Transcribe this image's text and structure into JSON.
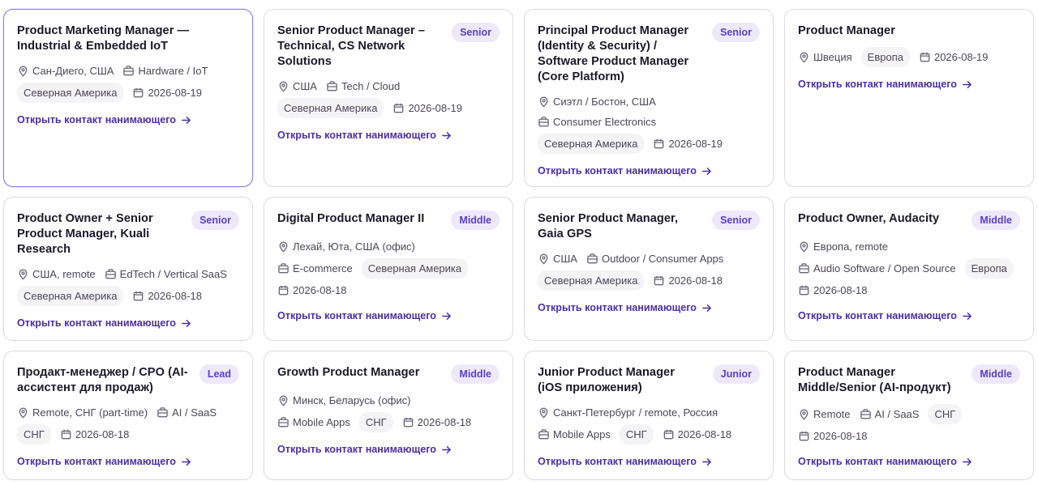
{
  "link_label": "Открыть контакт нанимающего",
  "accent_color": "#4a2fa8",
  "cards": [
    {
      "title": "Product Marketing Manager — Industrial & Embedded IoT",
      "level": "",
      "location": "Сан-Диего, США",
      "industry": "Hardware / IoT",
      "region": "Северная Америка",
      "date": "2026-08-19"
    },
    {
      "title": "Senior Product Manager – Technical, CS Network Solutions",
      "level": "Senior",
      "location": "США",
      "industry": "Tech / Cloud",
      "region": "Северная Америка",
      "date": "2026-08-19"
    },
    {
      "title": "Principal Product Manager (Identity & Security) / Software Product Manager (Core Platform)",
      "level": "Senior",
      "location": "Сиэтл / Бостон, США",
      "industry": "Consumer Electronics",
      "region": "Северная Америка",
      "date": "2026-08-19"
    },
    {
      "title": "Product Manager",
      "level": "",
      "location": "Швеция",
      "industry": "",
      "region": "Европа",
      "date": "2026-08-19"
    },
    {
      "title": "Product Owner + Senior Product Manager, Kuali Research",
      "level": "Senior",
      "location": "США, remote",
      "industry": "EdTech / Vertical SaaS",
      "region": "Северная Америка",
      "date": "2026-08-18"
    },
    {
      "title": "Digital Product Manager II",
      "level": "Middle",
      "location": "Лехай, Юта, США (офис)",
      "industry": "E-commerce",
      "region": "Северная Америка",
      "date": "2026-08-18"
    },
    {
      "title": "Senior Product Manager, Gaia GPS",
      "level": "Senior",
      "location": "США",
      "industry": "Outdoor / Consumer Apps",
      "region": "Северная Америка",
      "date": "2026-08-18"
    },
    {
      "title": "Product Owner, Audacity",
      "level": "Middle",
      "location": "Европа, remote",
      "industry": "Audio Software / Open Source",
      "region": "Европа",
      "date": "2026-08-18"
    },
    {
      "title": "Продакт-менеджер / CPO (AI-ассистент для продаж)",
      "level": "Lead",
      "location": "Remote, СНГ (part-time)",
      "industry": "AI / SaaS",
      "region": "СНГ",
      "date": "2026-08-18"
    },
    {
      "title": "Growth Product Manager",
      "level": "Middle",
      "location": "Минск, Беларусь (офис)",
      "industry": "Mobile Apps",
      "region": "СНГ",
      "date": "2026-08-18"
    },
    {
      "title": "Junior Product Manager (iOS приложения)",
      "level": "Junior",
      "location": "Санкт-Петербург / remote, Россия",
      "industry": "Mobile Apps",
      "region": "СНГ",
      "date": "2026-08-18"
    },
    {
      "title": "Product Manager Middle/Senior (AI-продукт)",
      "level": "Middle",
      "location": "Remote",
      "industry": "AI / SaaS",
      "region": "СНГ",
      "date": "2026-08-18"
    }
  ]
}
